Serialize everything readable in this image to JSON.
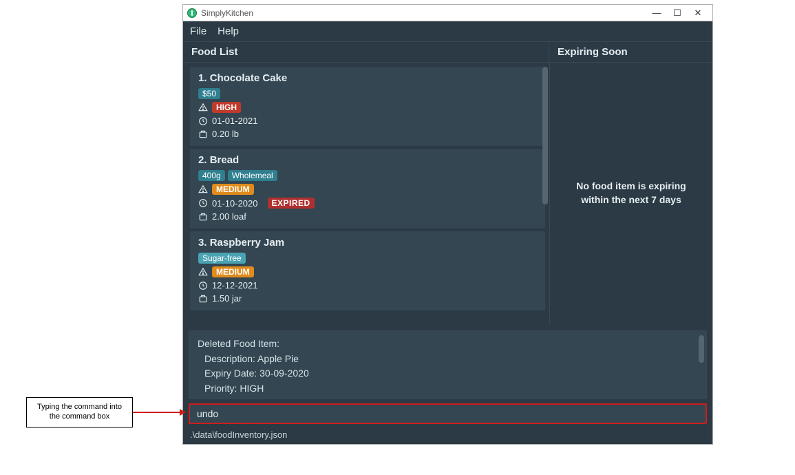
{
  "window": {
    "title": "SimplyKitchen"
  },
  "menubar": {
    "file": "File",
    "help": "Help"
  },
  "headers": {
    "foodlist": "Food List",
    "expiring": "Expiring Soon"
  },
  "food": [
    {
      "index": "1.",
      "name": "Chocolate Cake",
      "tags": [
        "$50"
      ],
      "priority": "HIGH",
      "priority_class": "tag-red",
      "date": "01-01-2021",
      "expired": false,
      "qty": "0.20 lb"
    },
    {
      "index": "2.",
      "name": "Bread",
      "tags": [
        "400g",
        "Wholemeal"
      ],
      "priority": "MEDIUM",
      "priority_class": "tag-orange",
      "date": "01-10-2020",
      "expired": true,
      "qty": "2.00 loaf"
    },
    {
      "index": "3.",
      "name": "Raspberry Jam",
      "tags": [
        "Sugar-free"
      ],
      "priority": "MEDIUM",
      "priority_class": "tag-orange",
      "date": "12-12-2021",
      "expired": false,
      "qty": "1.50 jar"
    }
  ],
  "expired_label": "EXPIRED",
  "side_message": "No food item is expiring within the next 7 days",
  "output": {
    "line1": "Deleted Food Item:",
    "line2": "Description: Apple Pie",
    "line3": "Expiry Date: 30-09-2020",
    "line4": "Priority: HIGH"
  },
  "command_value": "undo",
  "status_path": ".\\data\\foodInventory.json",
  "annotation": "Typing the command into the command box"
}
